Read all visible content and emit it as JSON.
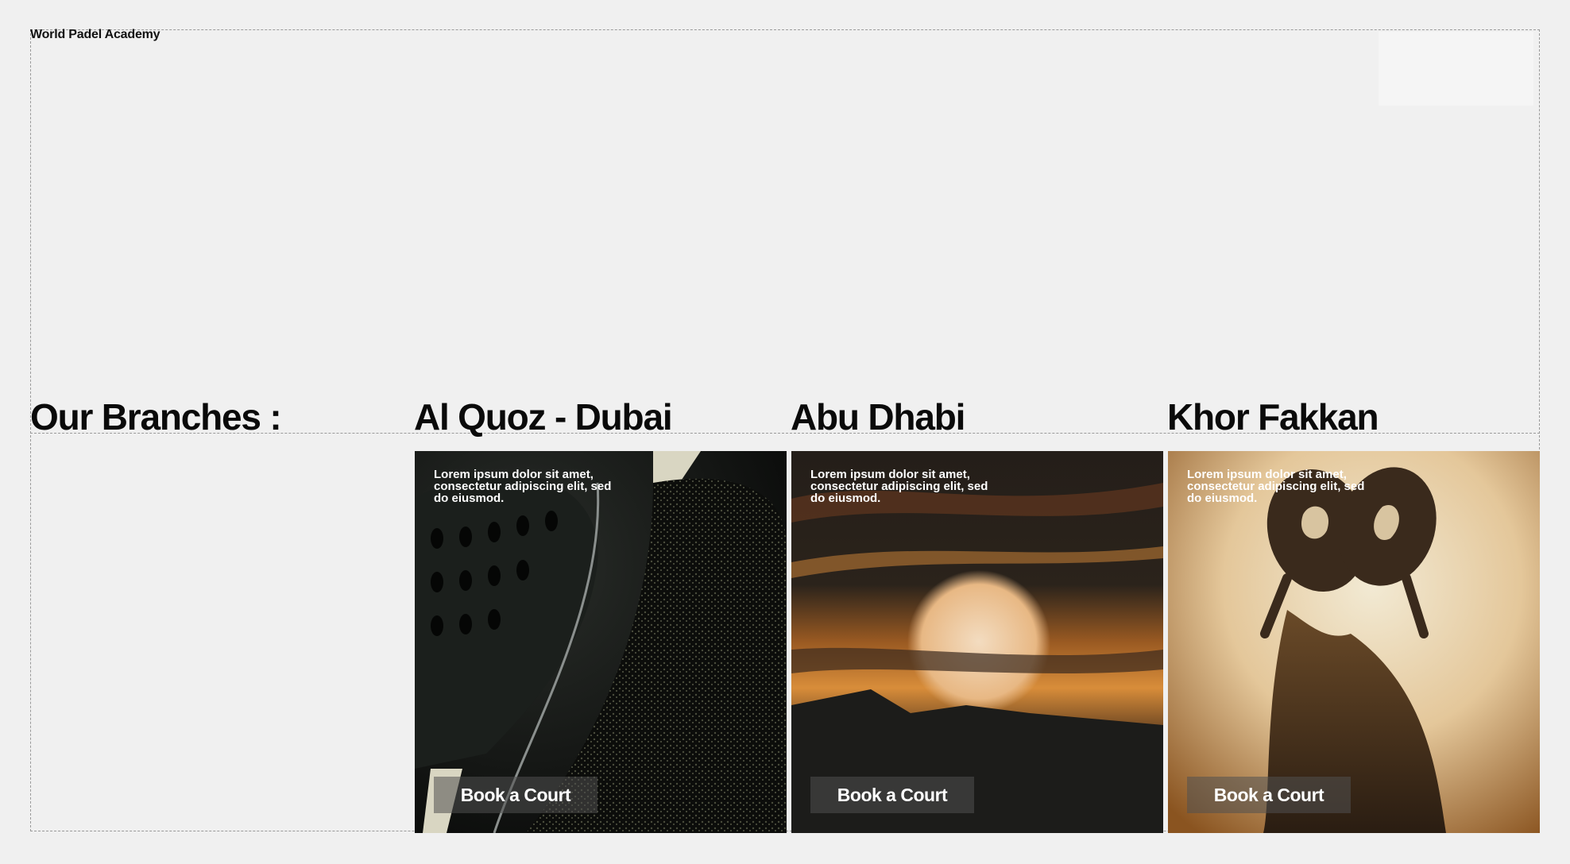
{
  "brand": {
    "name": "World Padel Academy"
  },
  "section": {
    "title": "Our Branches :"
  },
  "branches": [
    {
      "name": "Al Quoz - Dubai",
      "description": "Lorem ipsum dolor sit amet, consectetur adipiscing elit, sed do eiusmod.",
      "cta": "Book a Court"
    },
    {
      "name": "Abu Dhabi",
      "description": "Lorem ipsum dolor sit amet, consectetur adipiscing elit, sed do eiusmod.",
      "cta": "Book a Court"
    },
    {
      "name": "Khor Fakkan",
      "description": "Lorem ipsum dolor sit amet, consectetur adipiscing elit, sed do eiusmod.",
      "cta": "Book a Court"
    }
  ],
  "colors": {
    "background": "#f0f0f0",
    "text": "#0a0a0a",
    "button_overlay": "#505050"
  }
}
